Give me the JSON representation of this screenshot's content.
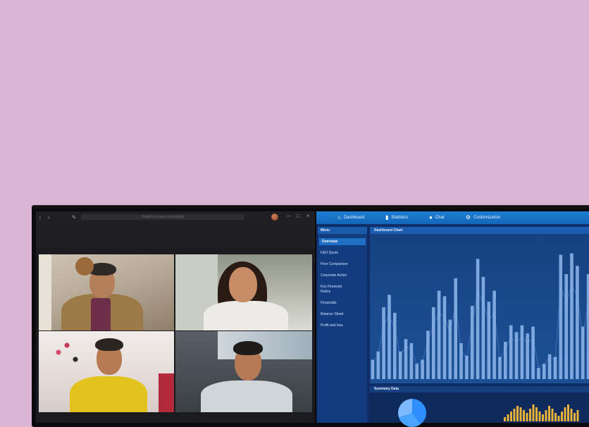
{
  "call_app": {
    "window_title": "Search or type a command"
  },
  "dashboard": {
    "nav": [
      {
        "label": "Dashboard",
        "icon": "home-icon"
      },
      {
        "label": "Statistics",
        "icon": "bar-chart-icon"
      },
      {
        "label": "Chat",
        "icon": "chat-icon"
      },
      {
        "label": "Customization",
        "icon": "gear-icon"
      }
    ],
    "menu_title": "Menu",
    "menu_items": [
      {
        "label": "Overview",
        "active": true
      },
      {
        "label": "F&O Quote"
      },
      {
        "label": "Peer Comparison"
      },
      {
        "label": "Corporate Action"
      },
      {
        "label": "Key Financial Ratios"
      },
      {
        "label": "Financials"
      },
      {
        "label": "Balance Sheet"
      },
      {
        "label": "Profit and loss"
      }
    ],
    "chart_title": "Dashboard Chart",
    "summary_title": "Summary Data"
  },
  "colors": {
    "background": "#dcb5d6",
    "dashboard_nav": "#1d7fd2",
    "bar": "#8fb8ec"
  },
  "chart_data": {
    "type": "bar",
    "values": [
      0.14,
      0.2,
      0.52,
      0.61,
      0.48,
      0.2,
      0.29,
      0.26,
      0.11,
      0.14,
      0.35,
      0.52,
      0.64,
      0.6,
      0.43,
      0.73,
      0.26,
      0.17,
      0.53,
      0.87,
      0.74,
      0.56,
      0.64,
      0.16,
      0.27,
      0.39,
      0.34,
      0.39,
      0.33,
      0.38,
      0.08,
      0.11,
      0.18,
      0.16,
      0.9,
      0.76,
      0.91,
      0.82,
      0.38,
      0.76
    ]
  }
}
